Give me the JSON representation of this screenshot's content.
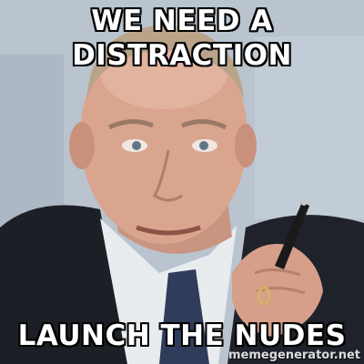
{
  "meme": {
    "top_line_1": "WE NEED A",
    "top_line_2": "DISTRACTION",
    "bottom_text": "LAUNCH THE NUDES",
    "watermark": "memegenerator.net"
  },
  "colors": {
    "text": "#ffffff",
    "outline": "#000000",
    "background": "#b7c3cf",
    "suit": "#1c1f26",
    "skin": "#d9a58f"
  },
  "icons": [
    "pen-icon",
    "ring-icon"
  ]
}
